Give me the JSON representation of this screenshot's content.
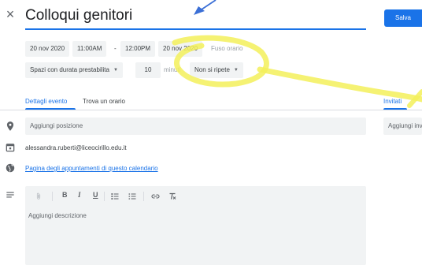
{
  "header": {
    "close_icon": "close-icon",
    "title": "Colloqui genitori",
    "save_label": "Salva"
  },
  "datetime": {
    "start_date": "20 nov 2020",
    "start_time": "11:00AM",
    "separator": "-",
    "end_time": "12:00PM",
    "end_date": "20 nov 2020",
    "timezone_link": "Fuso orario"
  },
  "slots": {
    "slot_type": "Spazi con durata prestabilita",
    "duration_value": "10",
    "duration_unit": "minuti",
    "repeat": "Non si ripete"
  },
  "tabs": {
    "details": "Dettagli evento",
    "find_time": "Trova un orario",
    "guests": "Invitati"
  },
  "fields": {
    "location_placeholder": "Aggiungi posizione",
    "calendar_owner": "alessandra.ruberti@liceocirillo.edu.it",
    "booking_page_link": "Pagina degli appuntamenti di questo calendario",
    "add_guests_placeholder": "Aggiungi inv",
    "description_placeholder": "Aggiungi descrizione"
  },
  "toolbar": {
    "attach_icon": "paperclip-icon",
    "bold": "B",
    "italic": "I",
    "underline": "U",
    "numbered_list_icon": "numbered-list-icon",
    "bulleted_list_icon": "bulleted-list-icon",
    "link_icon": "link-icon",
    "clear_format_icon": "clear-formatting-icon"
  },
  "colors": {
    "accent": "#1a73e8",
    "chip_bg": "#f1f3f4",
    "highlighter": "#f3f05a"
  }
}
